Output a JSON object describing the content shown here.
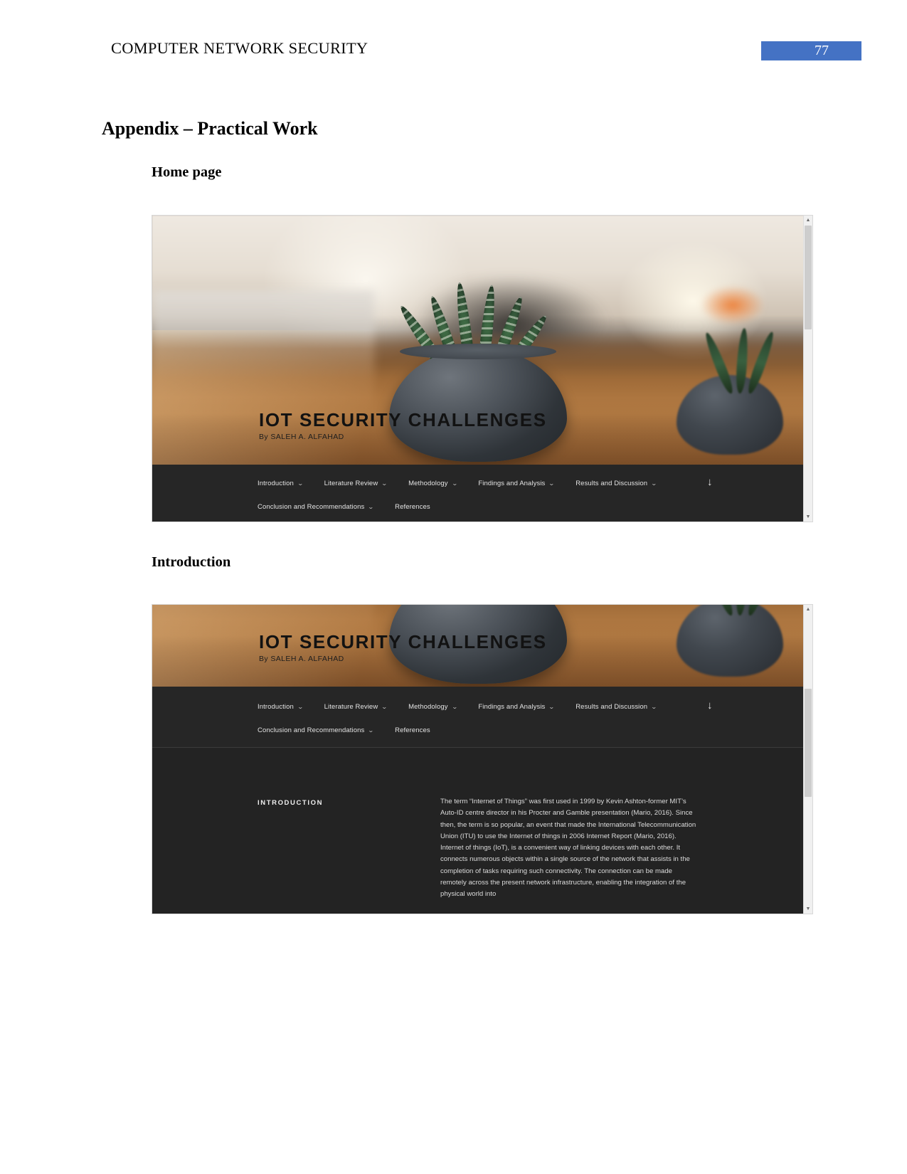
{
  "document": {
    "running_header": "COMPUTER NETWORK SECURITY",
    "page_number": "77",
    "accent_color": "#4472c4",
    "heading_1": "Appendix – Practical Work",
    "section_home_label": "Home page",
    "section_intro_label": "Introduction"
  },
  "website": {
    "hero_title": "IOT SECURITY CHALLENGES",
    "hero_byline": "By SALEH A. ALFAHAD",
    "nav_row_1": [
      {
        "label": "Introduction",
        "has_caret": true
      },
      {
        "label": "Literature Review",
        "has_caret": true
      },
      {
        "label": "Methodology",
        "has_caret": true
      },
      {
        "label": "Findings and Analysis",
        "has_caret": true
      },
      {
        "label": "Results and Discussion",
        "has_caret": true
      }
    ],
    "nav_row_2": [
      {
        "label": "Conclusion and Recommendations",
        "has_caret": true
      },
      {
        "label": "References",
        "has_caret": false
      }
    ],
    "scroll_down_arrow": "↓",
    "caret_glyph": "⌄",
    "intro_section": {
      "label": "INTRODUCTION",
      "paragraph": "The term “Internet of Things” was first used in 1999 by Kevin Ashton-former MIT’s Auto-ID centre director in his Procter and Gamble presentation (Mario, 2016). Since then, the term is so popular, an event that made the International Telecommunication Union (ITU) to use the Internet of things in 2006 Internet Report (Mario, 2016). Internet of things (IoT), is a convenient way of linking devices with each other. It connects numerous objects within a single source of the network that assists in the completion of tasks requiring such connectivity. The connection can be made remotely across the present network infrastructure, enabling the integration of the physical world into"
    }
  },
  "scrollbar": {
    "up_glyph": "▲",
    "down_glyph": "▼"
  }
}
